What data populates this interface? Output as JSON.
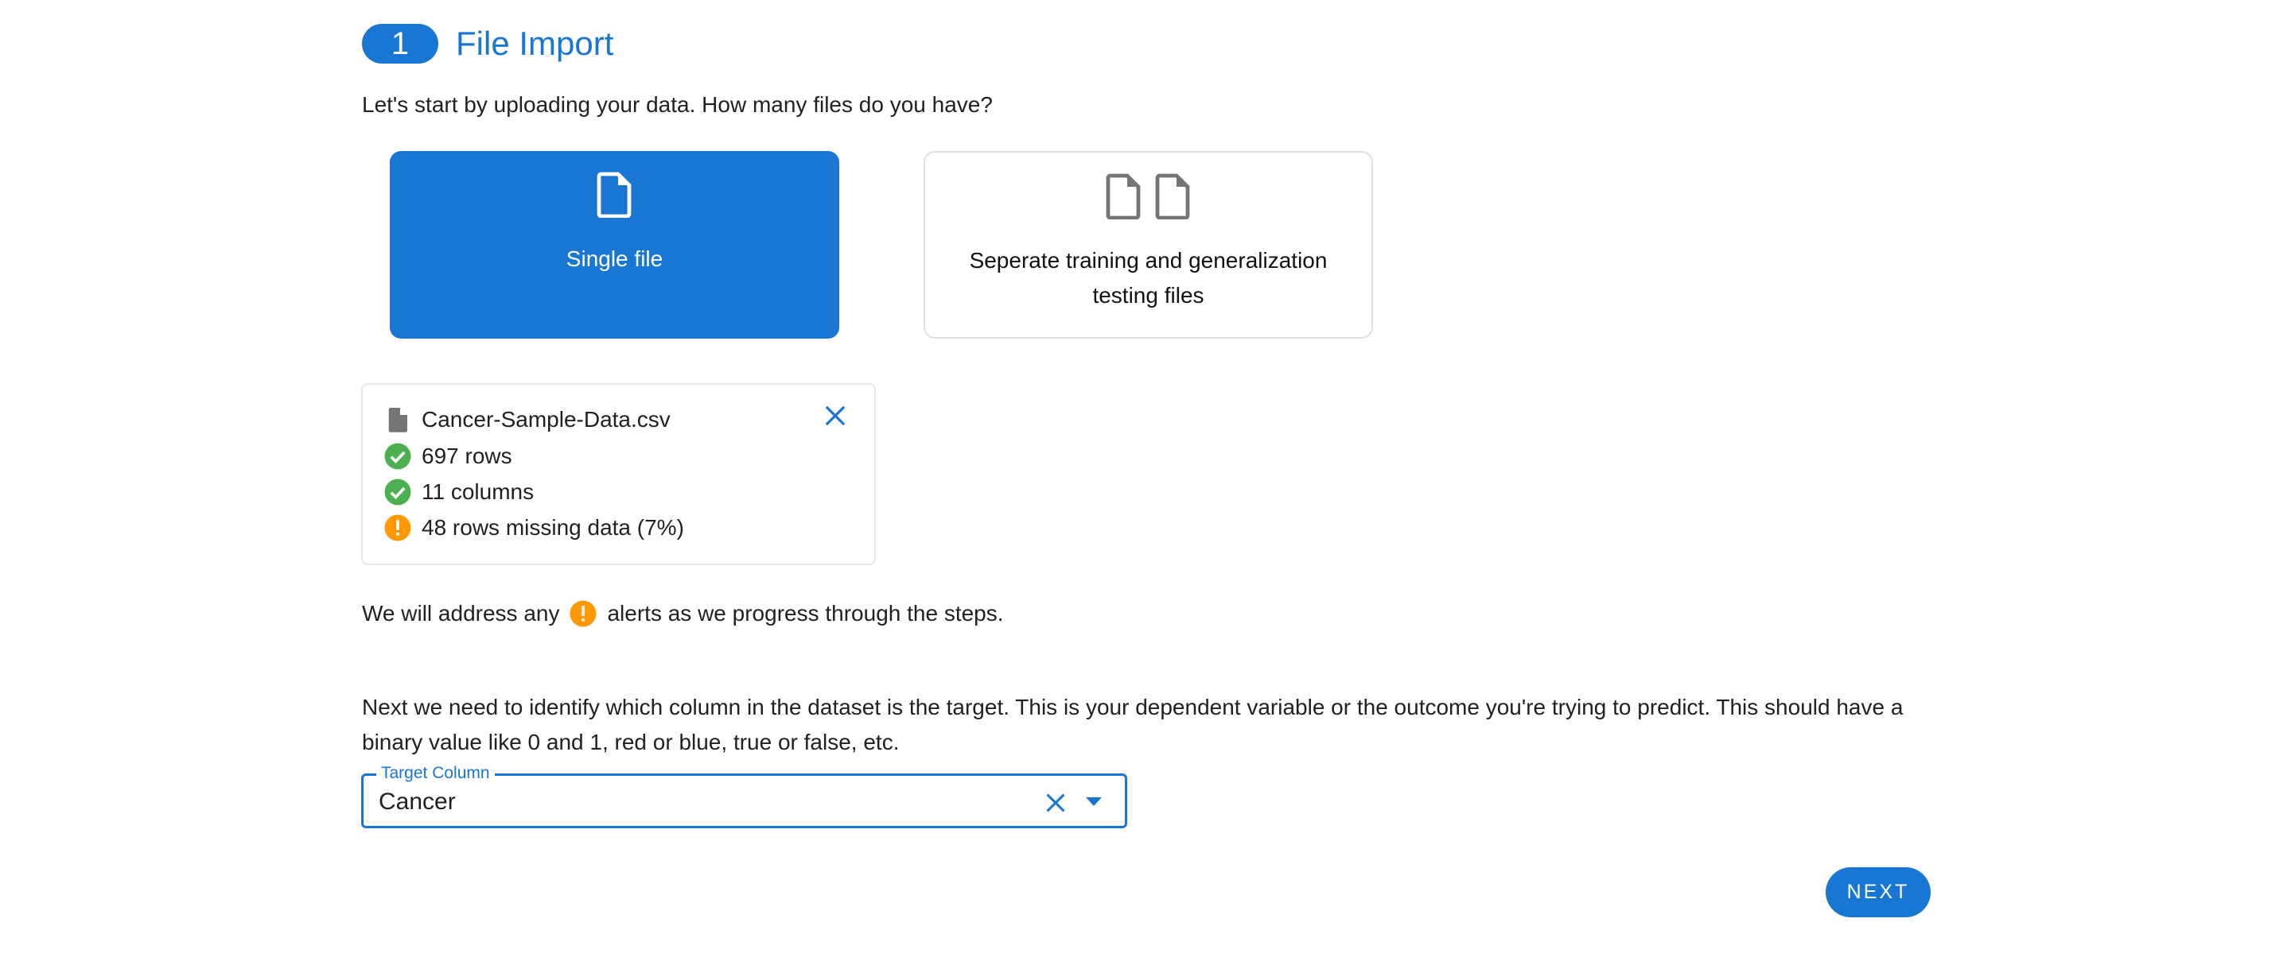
{
  "step": {
    "number": "1",
    "title": "File Import"
  },
  "intro_text": "Let's start by uploading your data. How many files do you have?",
  "choices": [
    {
      "label": "Single file",
      "icon": "file-icon",
      "selected": true
    },
    {
      "label": "Seperate training and generalization testing files",
      "icon": "two-files-icon",
      "selected": false
    }
  ],
  "file_summary": {
    "file_name": "Cancer-Sample-Data.csv",
    "file_icon": "file-icon",
    "close_icon": "close-icon",
    "checks": [
      {
        "status": "ok",
        "icon": "check-circle-icon",
        "text": "697 rows"
      },
      {
        "status": "ok",
        "icon": "check-circle-icon",
        "text": "11 columns"
      },
      {
        "status": "warning",
        "icon": "alert-circle-icon",
        "text": "48 rows missing data (7%)"
      }
    ]
  },
  "alert_note": {
    "before": "We will address any",
    "icon": "alert-circle-icon",
    "after": "alerts as we progress through the steps."
  },
  "target_paragraph": "Next we need to identify which column in the dataset is the target. This is your dependent variable or the outcome you're trying to predict. This should have a binary value like 0 and 1, red or blue, true or false, etc.",
  "target_select": {
    "label": "Target Column",
    "value": "Cancer",
    "clear_icon": "close-icon",
    "dropdown_icon": "caret-down-icon"
  },
  "next_button": {
    "label": "NEXT"
  },
  "colors": {
    "primary": "#1976d2",
    "success": "#4caf50",
    "warning": "#ff9800",
    "icon_gray": "#757575",
    "card_border": "#e0e0e0"
  }
}
